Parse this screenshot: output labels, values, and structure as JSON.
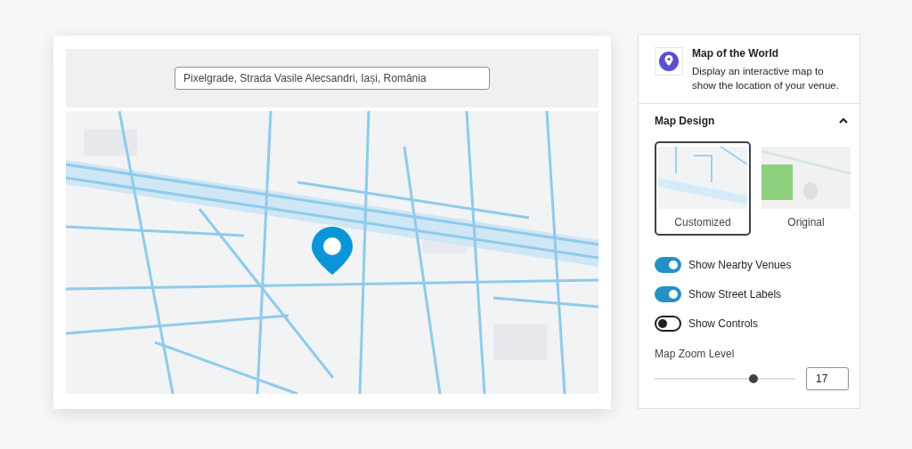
{
  "editor": {
    "address": {
      "value": "Pixelgrade, Strada Vasile Alecsandri, Iași, România"
    }
  },
  "block": {
    "title": "Map of the World",
    "description": "Display an interactive map to show the location of your venue."
  },
  "panel": {
    "title": "Map Design",
    "expanded": true,
    "designs": [
      {
        "label": "Customized",
        "selected": true,
        "kind": "customized"
      },
      {
        "label": "Original",
        "selected": false,
        "kind": "original"
      }
    ],
    "toggles": [
      {
        "label": "Show Nearby Venues",
        "on": true
      },
      {
        "label": "Show Street Labels",
        "on": true
      },
      {
        "label": "Show Controls",
        "on": false
      }
    ],
    "zoom": {
      "label": "Map Zoom Level",
      "level": 0.7,
      "value": "17"
    }
  }
}
